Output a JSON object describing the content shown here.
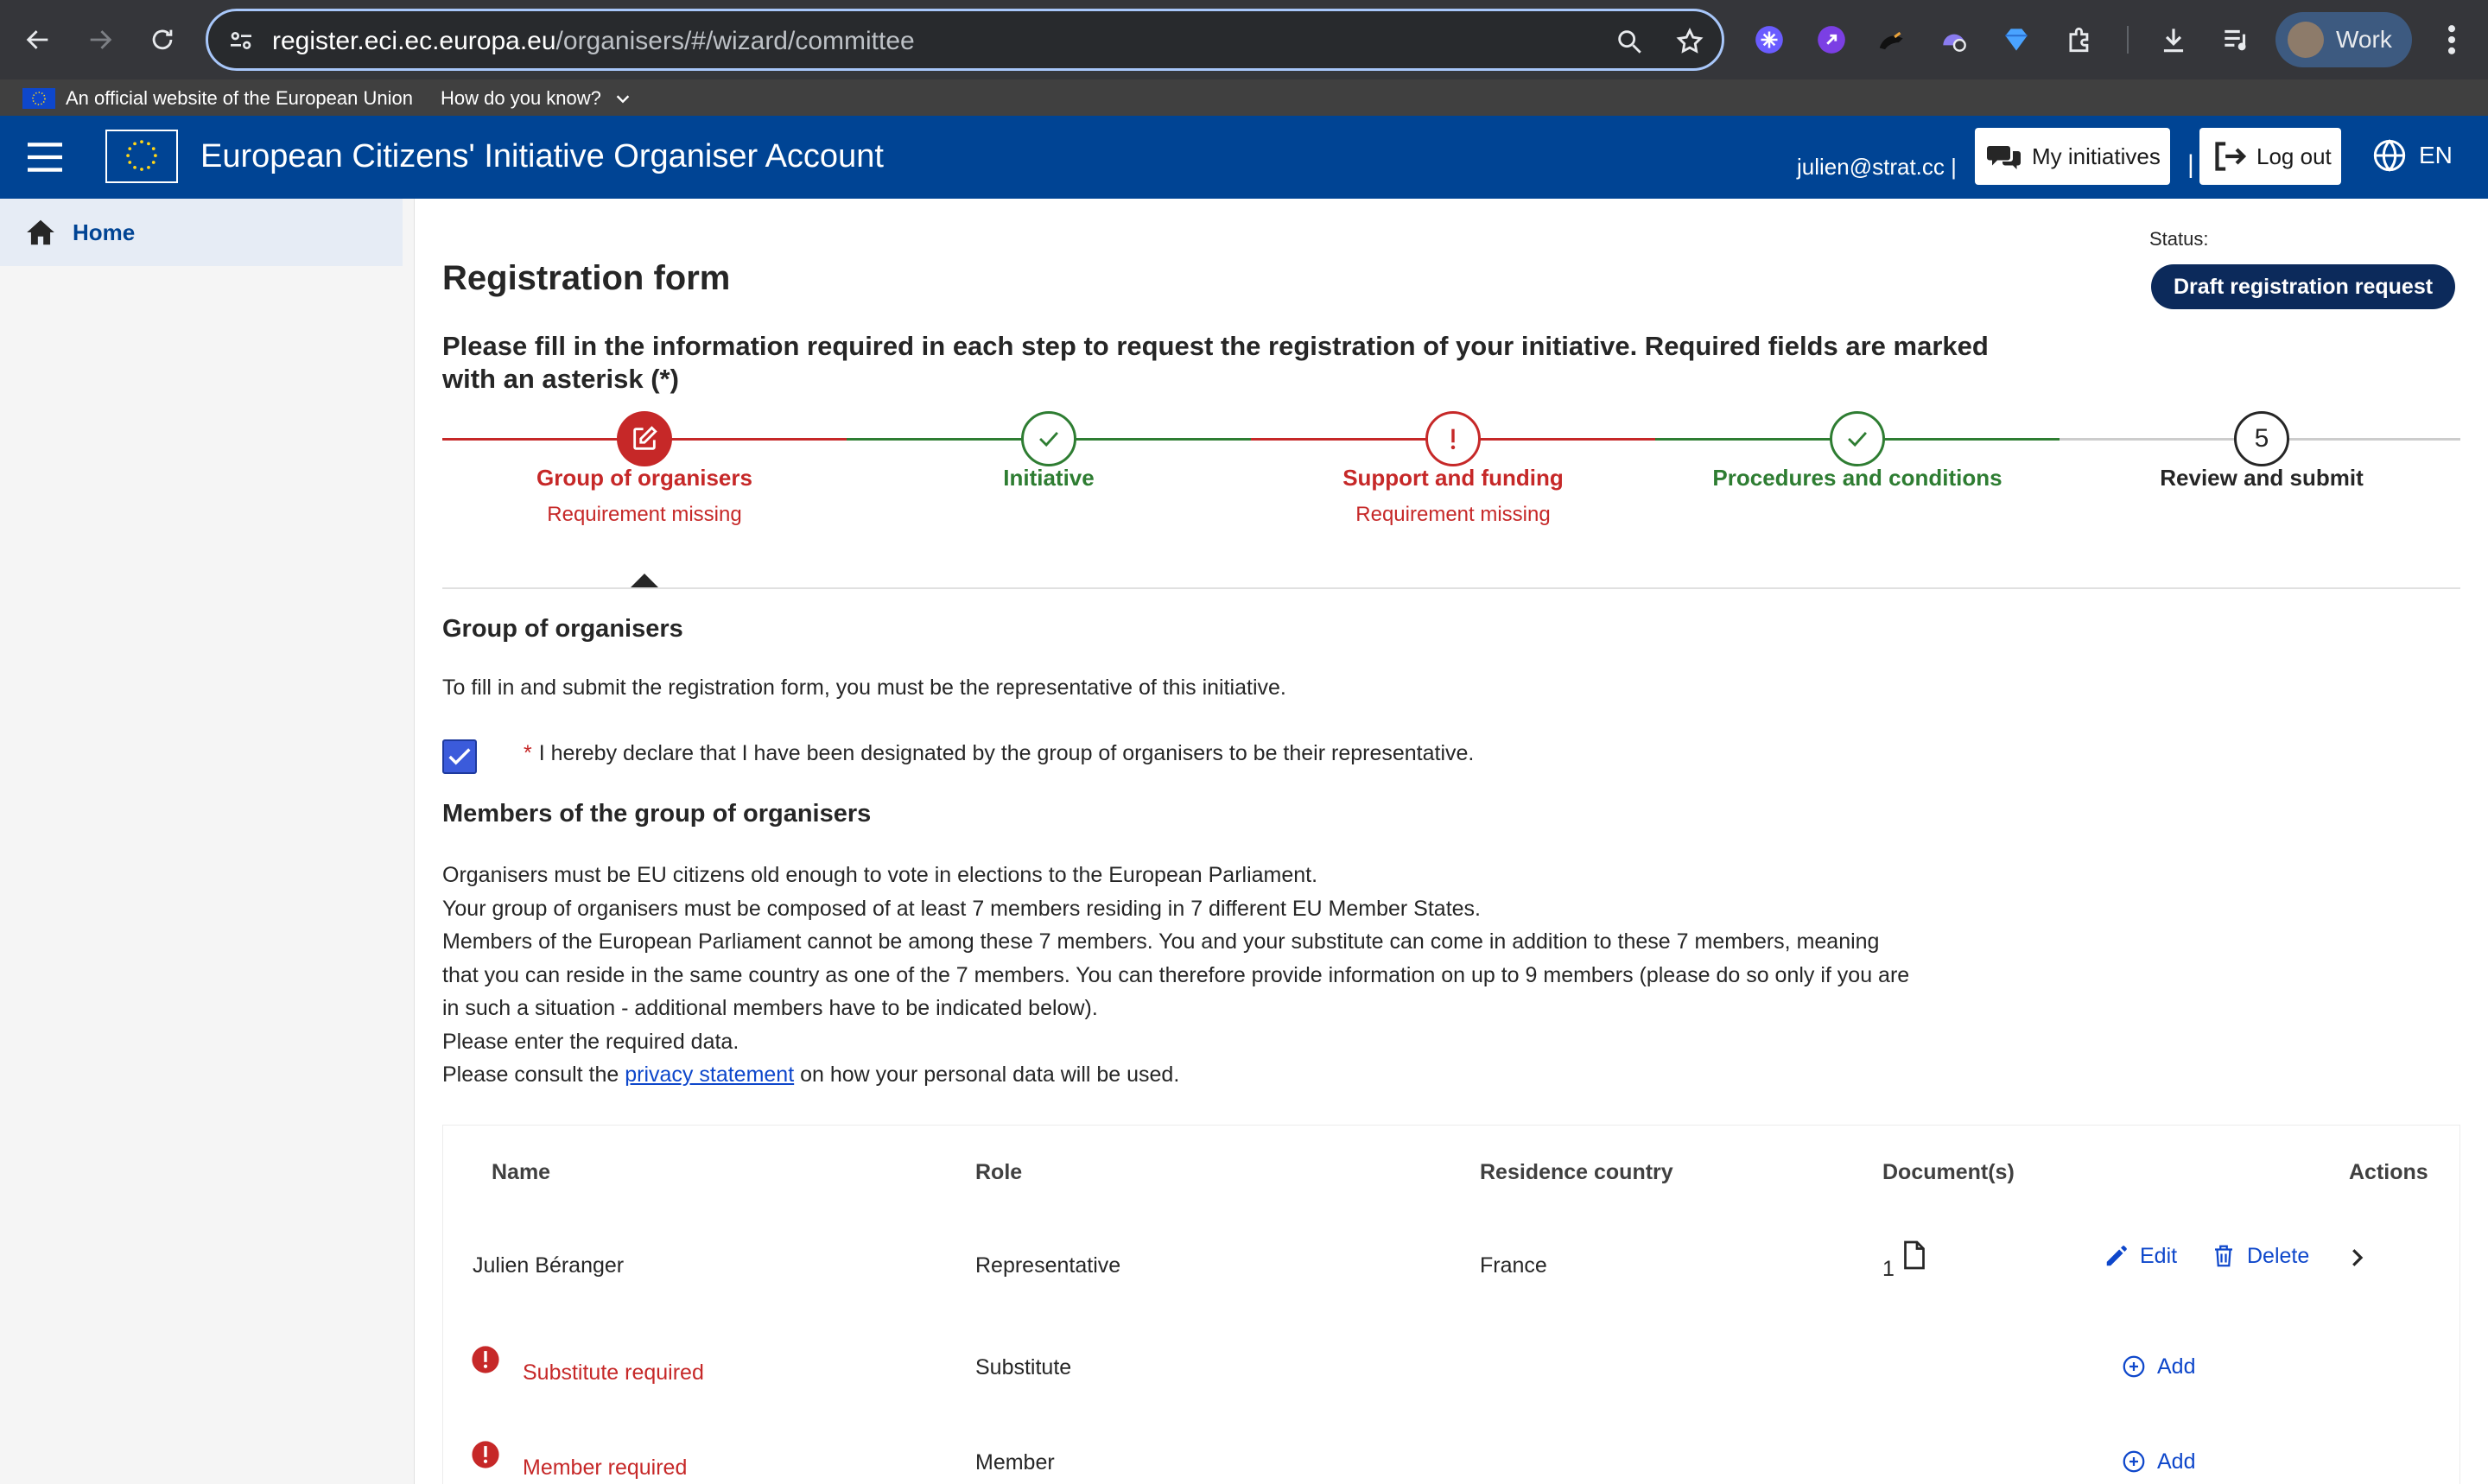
{
  "browser": {
    "url_host": "register.eci.ec.europa.eu",
    "url_path": "/organisers/#/wizard/committee",
    "profile_label": "Work"
  },
  "eu_banner": {
    "official_text": "An official website of the European Union",
    "how_text": "How do you know?"
  },
  "header": {
    "title": "European Citizens' Initiative Organiser Account",
    "user_email": "julien@strat.cc |",
    "separator": "|",
    "my_initiatives_label": "My initiatives",
    "logout_label": "Log out",
    "language": "EN"
  },
  "sidebar": {
    "home_label": "Home"
  },
  "page": {
    "status_label": "Status:",
    "status_value": "Draft registration request",
    "title": "Registration form",
    "instructions": "Please fill in the information required in each step to request the registration of your initiative. Required fields are marked with an asterisk (*)"
  },
  "stepper": {
    "steps": [
      {
        "label": "Group of organisers",
        "sub": "Requirement missing",
        "state": "active-error"
      },
      {
        "label": "Initiative",
        "sub": "",
        "state": "complete"
      },
      {
        "label": "Support and funding",
        "sub": "Requirement missing",
        "state": "error"
      },
      {
        "label": "Procedures and conditions",
        "sub": "",
        "state": "complete"
      },
      {
        "label": "Review and submit",
        "sub": "",
        "state": "pending",
        "number": "5"
      }
    ]
  },
  "group_section": {
    "heading": "Group of organisers",
    "intro": "To fill in and submit the registration form, you must be the representative of this initiative.",
    "declaration_asterisk": "*",
    "declaration": "I hereby declare that I have been designated by the group of organisers to be their representative.",
    "declaration_checked": true
  },
  "members_section": {
    "heading": "Members of the group of organisers",
    "line1": "Organisers must be EU citizens old enough to vote in elections to the European Parliament.",
    "line2": "Your group of organisers must be composed of at least 7 members residing in 7 different EU Member States.",
    "line3a": "Members of the European Parliament cannot be among these 7 members. You and your substitute can come in addition to these 7 members, meaning",
    "line3b": "that you can reside in the same country as one of the 7 members. You can therefore provide information on up to 9 members (please do so only if you are",
    "line3c": "in such a situation - additional members have to be indicated below).",
    "line4": "Please enter the required data.",
    "line5_pre": "Please consult the",
    "line5_link": "privacy statement",
    "line5_post": "on how your personal data will be used."
  },
  "table": {
    "headers": {
      "name": "Name",
      "role": "Role",
      "country": "Residence country",
      "documents": "Document(s)",
      "actions": "Actions"
    },
    "rows": [
      {
        "name": "Julien Béranger",
        "role": "Representative",
        "country": "France",
        "documents": "1",
        "edit": "Edit",
        "delete": "Delete"
      },
      {
        "name": "Substitute required",
        "role": "Substitute",
        "add": "Add"
      },
      {
        "name": "Member required",
        "role": "Member",
        "add": "Add"
      }
    ]
  },
  "colors": {
    "header_blue": "#004494",
    "error_red": "#c62828",
    "success_green": "#2e7d32",
    "status_navy": "#0c2a5b",
    "link_blue": "#0e47cb"
  }
}
